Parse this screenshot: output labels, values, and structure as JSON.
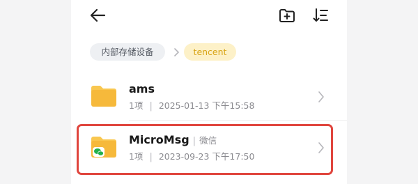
{
  "breadcrumb": {
    "items": [
      "内部存储设备",
      "tencent"
    ]
  },
  "files": [
    {
      "name": "ams",
      "tag": "",
      "count": "1项",
      "modified": "2025-01-13 下午15:58",
      "icon": "folder-icon"
    },
    {
      "name": "MicroMsg",
      "tag": "微信",
      "count": "1项",
      "modified": "2023-09-23 下午17:50",
      "icon": "wechat-folder-icon"
    }
  ],
  "colors": {
    "folder": "#f6b93b",
    "folder_tab": "#f9c74f",
    "accent": "#d9a517",
    "highlight": "#e0453d",
    "wechat": "#22b14c"
  }
}
